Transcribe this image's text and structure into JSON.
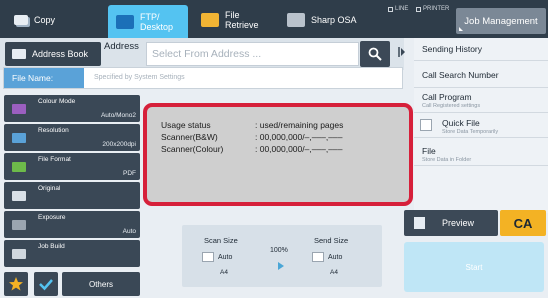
{
  "tabs": {
    "copy": "Copy",
    "ftp_line1": "FTP/",
    "ftp_line2": "Desktop",
    "file_line1": "File",
    "file_line2": "Retrieve",
    "osa": "Sharp OSA"
  },
  "indicators": {
    "line": "LINE",
    "printer": "PRINTER"
  },
  "job_management": "Job Management",
  "address": {
    "book_label": "Address Book",
    "label": "Address",
    "placeholder": "Select From Address ..."
  },
  "file_name": {
    "label": "File Name:",
    "value": "Specified by System Settings"
  },
  "right_menu": {
    "sending_history": "Sending History",
    "call_search_number": "Call Search Number",
    "call_program": "Call Program",
    "call_program_sub": "Call Registered settings",
    "quick_file": "Quick File",
    "quick_file_sub": "Store Data Temporarily",
    "file": "File",
    "file_sub": "Store Data in Folder"
  },
  "left_buttons": [
    {
      "label": "Colour Mode",
      "value": "Auto/Mono2",
      "icon": "colour-mode-icon"
    },
    {
      "label": "Resolution",
      "value": "200x200dpi",
      "icon": "resolution-icon"
    },
    {
      "label": "File Format",
      "value": "PDF",
      "icon": "file-format-icon"
    },
    {
      "label": "Original",
      "value": "",
      "icon": "original-icon"
    },
    {
      "label": "Exposure",
      "value": "Auto",
      "icon": "exposure-icon"
    },
    {
      "label": "Job Build",
      "value": "",
      "icon": "job-build-icon"
    }
  ],
  "others_label": "Others",
  "scan": {
    "scan_size_label": "Scan Size",
    "scan_size_value": "Auto",
    "scan_size_paper": "A4",
    "ratio": "100%",
    "send_size_label": "Send Size",
    "send_size_value": "Auto",
    "send_size_paper": "A4"
  },
  "preview_label": "Preview",
  "ca_label": "CA",
  "start_label": "Start",
  "usage": {
    "row1_label": "Usage status",
    "row1_value": ": used/remaining pages",
    "row2_label": "Scanner(B&W)",
    "row2_value": ": 00,000,000/–,–––,–––",
    "row3_label": "Scanner(Colour)",
    "row3_value": ": 00,000,000/–,–––,–––"
  },
  "colors": {
    "top_bar": "#2f3d4a",
    "active_tab": "#54c3f1",
    "popup_border": "#d6203a",
    "ca_button": "#f3b224",
    "start_button": "#bfe6f6"
  }
}
